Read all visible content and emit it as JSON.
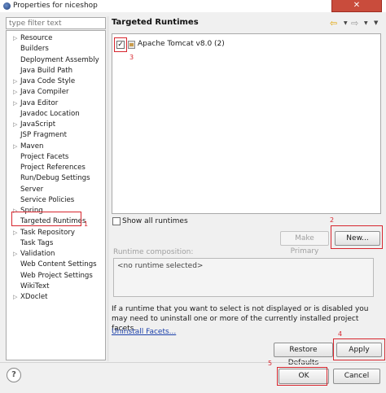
{
  "window": {
    "title": "Properties for niceshop",
    "close_glyph": "✕"
  },
  "filter": {
    "placeholder": "type filter text"
  },
  "tree": {
    "items": [
      {
        "label": "Resource",
        "expandable": true
      },
      {
        "label": "Builders",
        "expandable": false
      },
      {
        "label": "Deployment Assembly",
        "expandable": false
      },
      {
        "label": "Java Build Path",
        "expandable": false
      },
      {
        "label": "Java Code Style",
        "expandable": true
      },
      {
        "label": "Java Compiler",
        "expandable": true
      },
      {
        "label": "Java Editor",
        "expandable": true
      },
      {
        "label": "Javadoc Location",
        "expandable": false
      },
      {
        "label": "JavaScript",
        "expandable": true
      },
      {
        "label": "JSP Fragment",
        "expandable": false
      },
      {
        "label": "Maven",
        "expandable": true
      },
      {
        "label": "Project Facets",
        "expandable": false
      },
      {
        "label": "Project References",
        "expandable": false
      },
      {
        "label": "Run/Debug Settings",
        "expandable": false
      },
      {
        "label": "Server",
        "expandable": false
      },
      {
        "label": "Service Policies",
        "expandable": false
      },
      {
        "label": "Spring",
        "expandable": true
      },
      {
        "label": "Targeted Runtimes",
        "expandable": false,
        "selected": true
      },
      {
        "label": "Task Repository",
        "expandable": true
      },
      {
        "label": "Task Tags",
        "expandable": false
      },
      {
        "label": "Validation",
        "expandable": true
      },
      {
        "label": "Web Content Settings",
        "expandable": false
      },
      {
        "label": "Web Project Settings",
        "expandable": false
      },
      {
        "label": "WikiText",
        "expandable": false
      },
      {
        "label": "XDoclet",
        "expandable": true
      }
    ]
  },
  "main": {
    "title": "Targeted Runtimes",
    "runtimes": [
      {
        "label": "Apache Tomcat v8.0 (2)",
        "checked": true
      }
    ],
    "show_all_label": "Show all runtimes",
    "make_primary_label": "Make Primary",
    "new_label": "New...",
    "composition_label": "Runtime composition:",
    "composition_empty": "<no runtime selected>",
    "info_text": "If a runtime that you want to select is not displayed or is disabled you may need to uninstall one or more of the currently installed project facets.",
    "uninstall_link": "Uninstall Facets...",
    "restore_defaults_label": "Restore Defaults",
    "apply_label": "Apply"
  },
  "footer": {
    "help_glyph": "?",
    "ok_label": "OK",
    "cancel_label": "Cancel"
  },
  "annotations": {
    "step1": "1",
    "step2": "2",
    "step3": "3",
    "step4": "4",
    "step5": "5",
    "color": "#d7262e"
  },
  "icons": {
    "back_arrow": "⇦",
    "forward_arrow": "⇨",
    "dropdown": "▼",
    "view_menu": "▼",
    "tree_expand": "▷",
    "check": "✓"
  }
}
